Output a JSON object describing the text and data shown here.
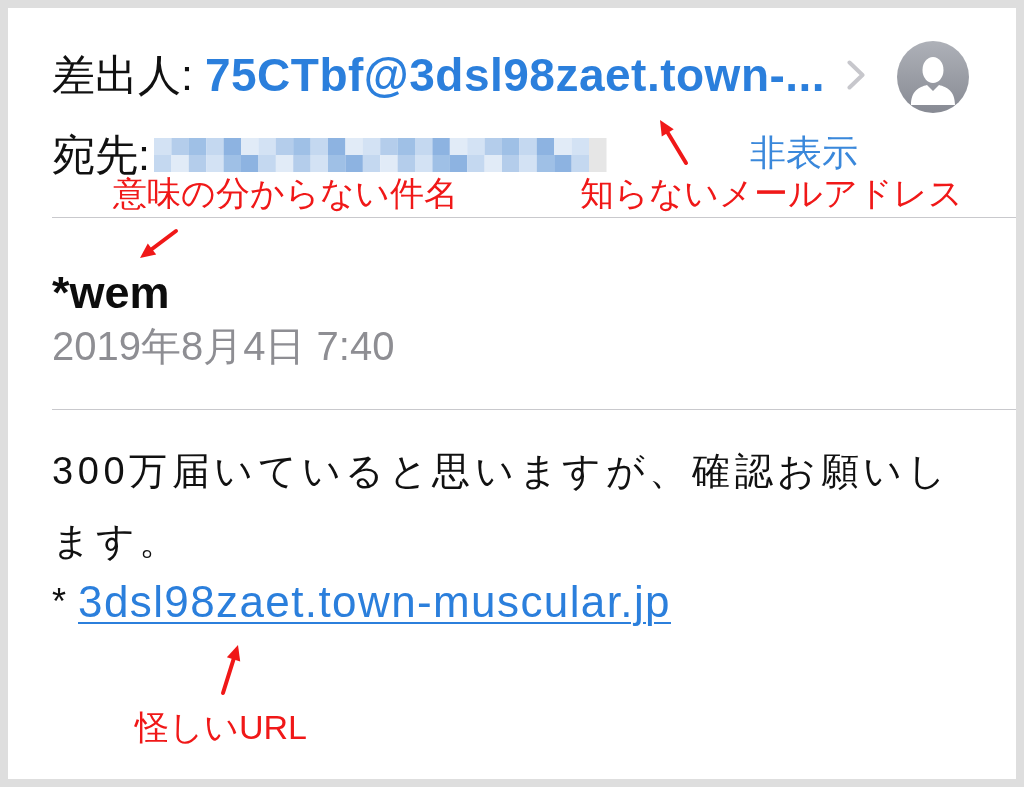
{
  "header": {
    "from_label": "差出人:",
    "from_address": "75CTbf@3dsl98zaet.town-...",
    "to_label": "宛先:",
    "hide_label": "非表示"
  },
  "subject": "*wem",
  "date": "2019年8月4日 7:40",
  "body": {
    "text": "300万届いていると思いますが、確認お願いします。",
    "bullet": "*",
    "link": "3dsl98zaet.town-muscular.jp"
  },
  "annotations": [
    {
      "text": "意味の分からない件名",
      "kind": "subject"
    },
    {
      "text": "知らないメールアドレス",
      "kind": "sender"
    },
    {
      "text": "怪しいURL",
      "kind": "url"
    }
  ]
}
